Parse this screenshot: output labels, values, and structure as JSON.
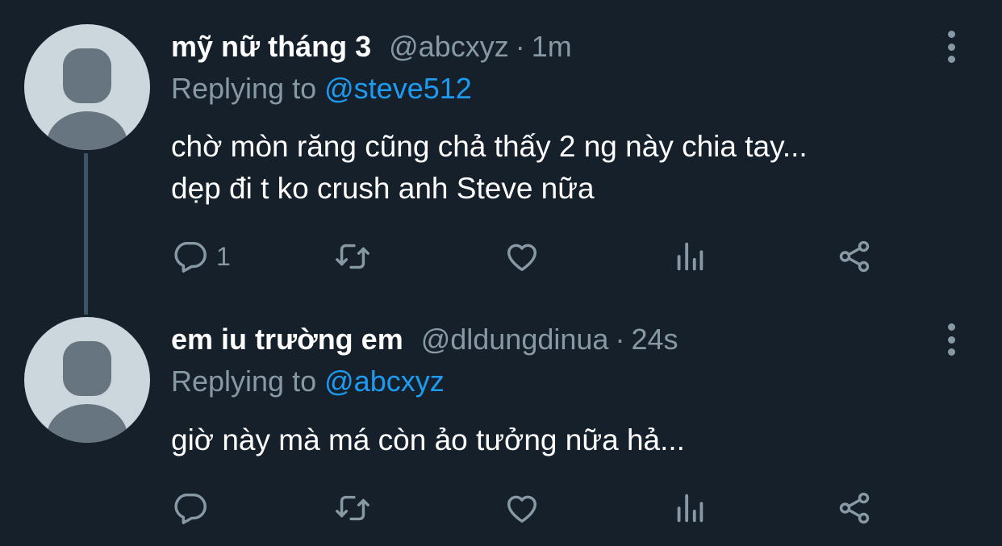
{
  "tweets": [
    {
      "display_name": "mỹ nữ tháng 3",
      "handle": "@abcxyz",
      "separator": "·",
      "time": "1m",
      "replying_prefix": "Replying to",
      "replying_to": "@steve512",
      "text_lines": [
        "chờ mòn răng cũng chả thấy 2 ng này chia tay...",
        "dẹp đi t ko crush anh Steve nữa"
      ],
      "reply_count": "1",
      "icons": [
        "more-icon",
        "reply-icon",
        "retweet-icon",
        "like-icon",
        "analytics-icon",
        "share-icon"
      ]
    },
    {
      "display_name": "em iu trường em",
      "handle": "@dldungdinua",
      "separator": "·",
      "time": "24s",
      "replying_prefix": "Replying to",
      "replying_to": "@abcxyz",
      "text_lines": [
        "giờ này mà má còn ảo tưởng nữa hả..."
      ],
      "reply_count": "",
      "icons": [
        "more-icon",
        "reply-icon",
        "retweet-icon",
        "like-icon",
        "analytics-icon",
        "share-icon"
      ]
    }
  ],
  "colors": {
    "background": "#15202b",
    "secondary_text": "#8899a6",
    "link": "#1d9bf0",
    "avatar_bg": "#ccd6dd",
    "avatar_fg": "#66757f"
  }
}
